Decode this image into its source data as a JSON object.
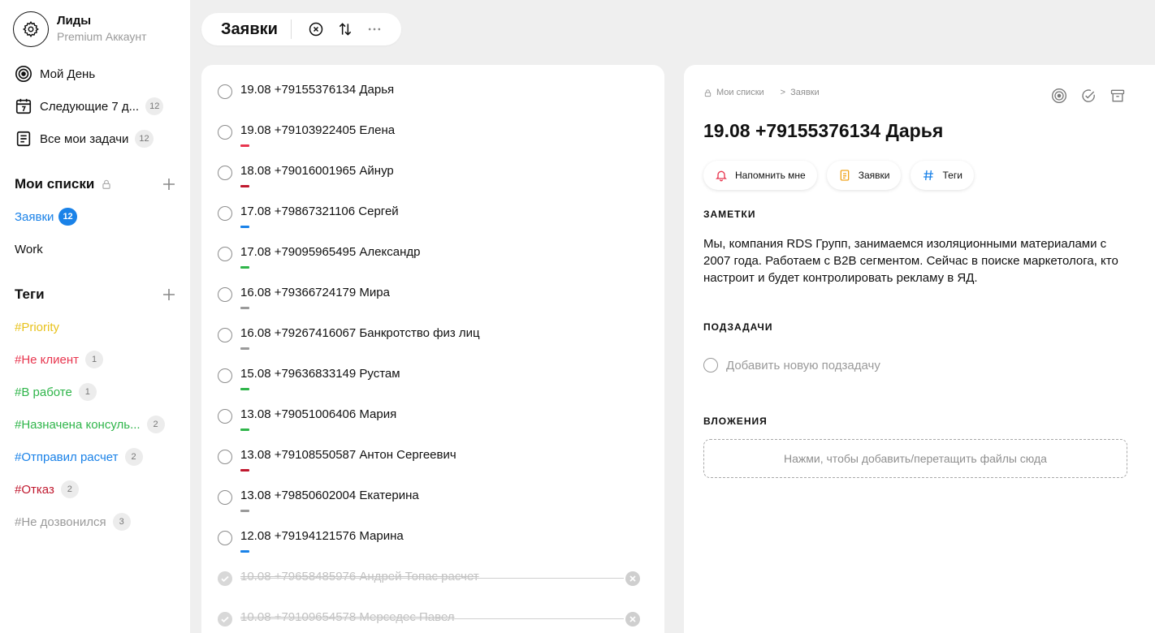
{
  "profile": {
    "name": "Лиды",
    "plan": "Premium Аккаунт"
  },
  "nav": [
    {
      "label": "Мой День",
      "icon": "target-icon",
      "count": ""
    },
    {
      "label": "Следующие 7 д...",
      "icon": "calendar-7-icon",
      "count": "12"
    },
    {
      "label": "Все мои задачи",
      "icon": "list-doc-icon",
      "count": "12"
    }
  ],
  "lists_section": {
    "title": "Мои списки"
  },
  "lists": [
    {
      "label": "Заявки",
      "count": "12",
      "color": "#1a82e8"
    },
    {
      "label": "Work",
      "count": "",
      "color": "#111111"
    }
  ],
  "tags_section": {
    "title": "Теги"
  },
  "tags": [
    {
      "label": "#Priority",
      "count": "",
      "color": "#e8c21c"
    },
    {
      "label": "#Не клиент",
      "count": "1",
      "color": "#e8364f"
    },
    {
      "label": "#В работе",
      "count": "1",
      "color": "#2fb54a"
    },
    {
      "label": "#Назначена консуль...",
      "count": "2",
      "color": "#2fb54a"
    },
    {
      "label": "#Отправил расчет",
      "count": "2",
      "color": "#1a82e8"
    },
    {
      "label": "#Отказ",
      "count": "2",
      "color": "#c0182e"
    },
    {
      "label": "#Не дозвонился",
      "count": "3",
      "color": "#9a9a9a"
    }
  ],
  "toolbar": {
    "title": "Заявки"
  },
  "tasks": [
    {
      "title": "19.08 +79155376134 Дарья",
      "tag_color": "",
      "done": false
    },
    {
      "title": "19.08 +79103922405 Елена",
      "tag_color": "#e8364f",
      "done": false
    },
    {
      "title": "18.08 +79016001965 Айнур",
      "tag_color": "#c0182e",
      "done": false
    },
    {
      "title": "17.08 +79867321106 Сергей",
      "tag_color": "#1a82e8",
      "done": false
    },
    {
      "title": "17.08 +79095965495 Александр",
      "tag_color": "#2fb54a",
      "done": false
    },
    {
      "title": "16.08 +79366724179 Мира",
      "tag_color": "#9a9a9a",
      "done": false
    },
    {
      "title": "16.08 +79267416067 Банкротство физ лиц",
      "tag_color": "#9a9a9a",
      "done": false
    },
    {
      "title": "15.08 +79636833149 Рустам",
      "tag_color": "#2fb54a",
      "done": false
    },
    {
      "title": "13.08 +79051006406 Мария",
      "tag_color": "#2fb54a",
      "done": false
    },
    {
      "title": "13.08 +79108550587 Антон Сергеевич",
      "tag_color": "#c0182e",
      "done": false
    },
    {
      "title": "13.08 +79850602004 Екатерина",
      "tag_color": "#9a9a9a",
      "done": false
    },
    {
      "title": "12.08 +79194121576 Марина",
      "tag_color": "#1a82e8",
      "done": false
    },
    {
      "title": "10.08 +79658485976 Андрей Топас расчет",
      "tag_color": "",
      "done": true
    },
    {
      "title": "10.08 +79109654578 Мерседес Павел",
      "tag_color": "",
      "done": true
    }
  ],
  "detail": {
    "breadcrumb": {
      "root": "Мои списки",
      "sep": ">",
      "current": "Заявки"
    },
    "title": "19.08 +79155376134 Дарья",
    "chips": [
      {
        "label": "Напомнить мне",
        "icon": "bell-icon",
        "color": "#e8364f"
      },
      {
        "label": "Заявки",
        "icon": "document-icon",
        "color": "#f0a31c"
      },
      {
        "label": "Теги",
        "icon": "hash-icon",
        "color": "#1a82e8"
      }
    ],
    "notes_label": "ЗАМЕТКИ",
    "notes_text": "Мы, компания RDS Групп, занимаемся изоляционными материалами с 2007 года. Работаем с B2B сегментом. Сейчас в поиске маркетолога, кто настроит и будет контролировать рекламу в ЯД.",
    "subtasks_label": "ПОДЗАДАЧИ",
    "subtask_placeholder": "Добавить новую подзадачу",
    "attachments_label": "ВЛОЖЕНИЯ",
    "dropzone_text": "Нажми, чтобы добавить/перетащить файлы сюда"
  }
}
